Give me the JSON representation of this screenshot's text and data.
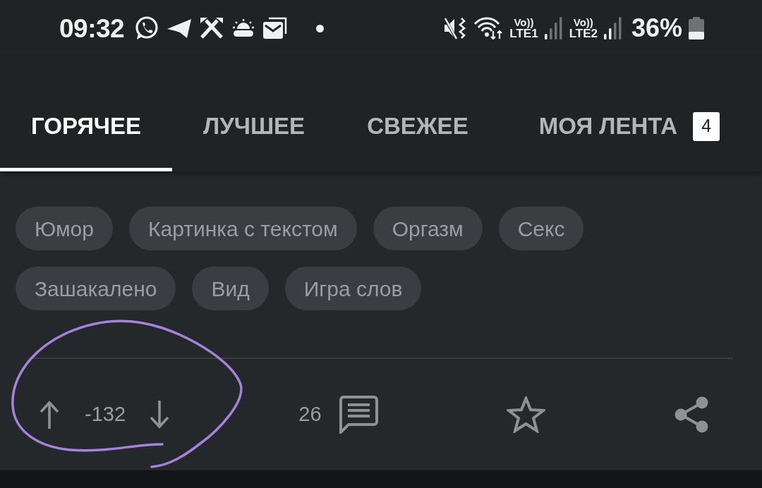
{
  "status_bar": {
    "time": "09:32",
    "sims": [
      {
        "volte": "Vo))",
        "network": "LTE1"
      },
      {
        "volte": "Vo))",
        "network": "LTE2"
      }
    ],
    "battery": "36%"
  },
  "tabs": [
    {
      "label": "ГОРЯЧЕЕ",
      "selected": true
    },
    {
      "label": "ЛУЧШЕЕ",
      "selected": false
    },
    {
      "label": "СВЕЖЕЕ",
      "selected": false
    },
    {
      "label": "МОЯ ЛЕНТА",
      "selected": false,
      "badge": "4"
    }
  ],
  "tags": [
    "Юмор",
    "Картинка с текстом",
    "Оргазм",
    "Секс",
    "Зашакалено",
    "Вид",
    "Игра слов"
  ],
  "actions": {
    "rating": "-132",
    "comments": "26"
  },
  "annotation": {
    "kind": "circle"
  }
}
